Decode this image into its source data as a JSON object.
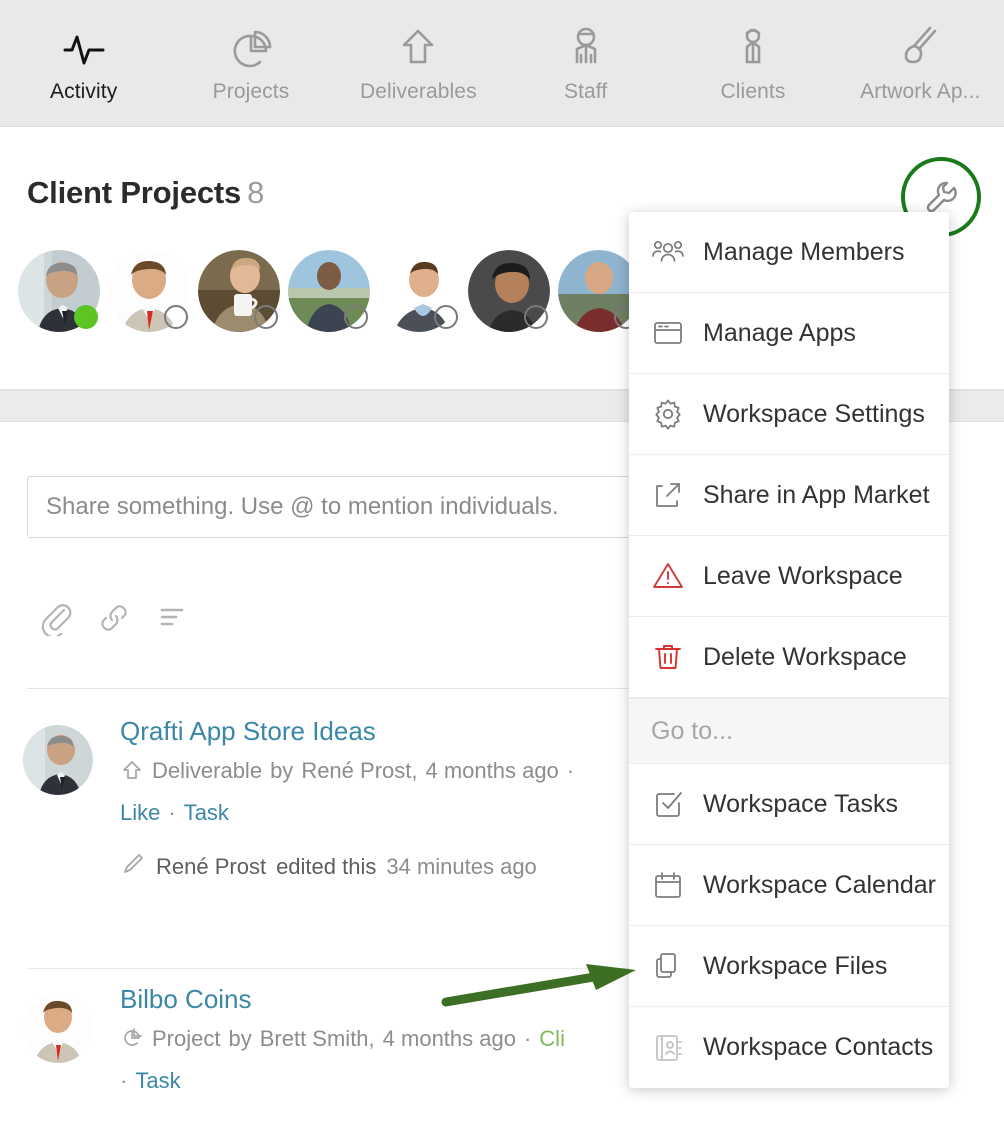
{
  "topnav": {
    "items": [
      {
        "label": "Activity",
        "icon": "activity-pulse-icon",
        "active": true
      },
      {
        "label": "Projects",
        "icon": "pie-chart-icon",
        "active": false
      },
      {
        "label": "Deliverables",
        "icon": "up-arrow-icon",
        "active": false
      },
      {
        "label": "Staff",
        "icon": "person-staff-icon",
        "active": false
      },
      {
        "label": "Clients",
        "icon": "person-client-icon",
        "active": false
      },
      {
        "label": "Artwork Ap...",
        "icon": "paintbrush-icon",
        "active": false
      }
    ]
  },
  "header": {
    "title": "Client Projects",
    "count": "8",
    "settings_icon": "wrench-icon",
    "highlight_color": "#1a7a1a",
    "members": [
      {
        "name": "member-1",
        "status": "online"
      },
      {
        "name": "member-2",
        "status": "offline"
      },
      {
        "name": "member-3",
        "status": "offline"
      },
      {
        "name": "member-4",
        "status": "offline"
      },
      {
        "name": "member-5",
        "status": "offline"
      },
      {
        "name": "member-6",
        "status": "offline"
      },
      {
        "name": "member-7",
        "status": "offline"
      }
    ]
  },
  "composer": {
    "placeholder": "Share something. Use @ to mention individuals.",
    "value": "",
    "tools": [
      {
        "name": "attach-file-icon",
        "label": "Attach file"
      },
      {
        "name": "insert-link-icon",
        "label": "Insert link"
      },
      {
        "name": "format-text-icon",
        "label": "Format text"
      }
    ]
  },
  "feed": {
    "items": [
      {
        "title": "Qrafti App Store Ideas",
        "type_icon": "up-arrow-icon",
        "type": "Deliverable",
        "by": "by",
        "author": "René Prost,",
        "time": "4 months ago",
        "sep": "·",
        "actions": [
          "Like",
          "Task"
        ],
        "action_sep": "·",
        "edit": {
          "icon": "pencil-icon",
          "author": "René Prost",
          "verb": "edited this",
          "time": "34 minutes ago"
        }
      },
      {
        "title": "Bilbo Coins",
        "type_icon": "pie-chart-icon",
        "type": "Project",
        "by": "by",
        "author": "Brett Smith,",
        "time": "4 months ago",
        "sep": "·",
        "tag": "Cli",
        "actions": [
          "Task"
        ],
        "action_sep": "·"
      }
    ]
  },
  "dropdown": {
    "items": [
      {
        "label": "Manage Members",
        "icon": "group-people-icon",
        "kind": "item",
        "color": "#6e6e6e"
      },
      {
        "label": "Manage Apps",
        "icon": "window-app-icon",
        "kind": "item",
        "color": "#6e6e6e"
      },
      {
        "label": "Workspace Settings",
        "icon": "gear-icon",
        "kind": "item",
        "color": "#6e6e6e"
      },
      {
        "label": "Share in App Market",
        "icon": "share-out-icon",
        "kind": "item",
        "color": "#6e6e6e"
      },
      {
        "label": "Leave Workspace",
        "icon": "warning-icon",
        "kind": "item",
        "color": "#cf3b3b"
      },
      {
        "label": "Delete Workspace",
        "icon": "trash-icon",
        "kind": "item",
        "color": "#cf3b3b"
      },
      {
        "label": "Go to...",
        "icon": "",
        "kind": "section",
        "color": "#a6a6a6"
      },
      {
        "label": "Workspace Tasks",
        "icon": "checkbox-task-icon",
        "kind": "item",
        "color": "#6e6e6e"
      },
      {
        "label": "Workspace Calendar",
        "icon": "calendar-icon",
        "kind": "item",
        "color": "#6e6e6e"
      },
      {
        "label": "Workspace Files",
        "icon": "files-copy-icon",
        "kind": "item",
        "color": "#6e6e6e"
      },
      {
        "label": "Workspace Contacts",
        "icon": "contacts-book-icon",
        "kind": "item",
        "color": "#bdbdbd"
      }
    ]
  },
  "annotations": {
    "arrow_target": "Workspace Files",
    "circle_target": "wrench-icon",
    "color": "#3c6e24"
  }
}
